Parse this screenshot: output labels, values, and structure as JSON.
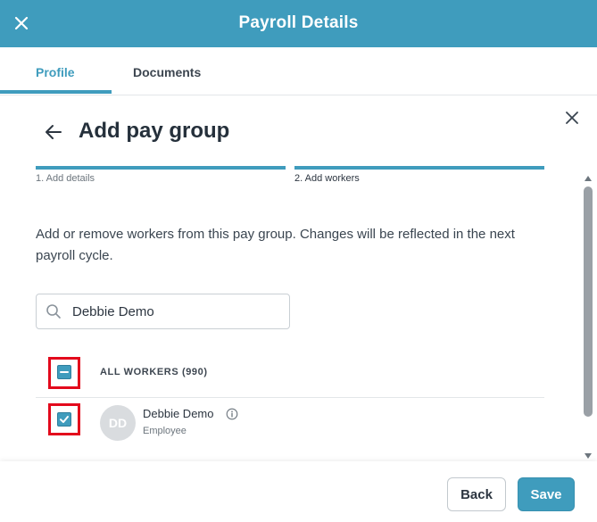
{
  "header": {
    "title": "Payroll Details"
  },
  "tabs": [
    {
      "label": "Profile",
      "active": true
    },
    {
      "label": "Documents",
      "active": false
    }
  ],
  "panel": {
    "heading": "Add pay group",
    "steps": [
      {
        "label": "1. Add details",
        "state": "completed"
      },
      {
        "label": "2. Add workers",
        "state": "current"
      }
    ],
    "description": "Add or remove workers from this pay group. Changes will be reflected in the next payroll cycle.",
    "search": {
      "value": "Debbie Demo",
      "placeholder": ""
    },
    "all_workers": {
      "label": "ALL WORKERS (990)",
      "checkbox_state": "indeterminate"
    },
    "workers": [
      {
        "initials": "DD",
        "name": "Debbie Demo",
        "role": "Employee",
        "checked": true
      }
    ]
  },
  "footer": {
    "back_label": "Back",
    "save_label": "Save"
  },
  "colors": {
    "accent": "#3f9cbd",
    "highlight_box": "#e3091c",
    "avatar_bg": "#d9dcdf"
  },
  "icons": [
    "close-icon",
    "back-arrow-icon",
    "search-icon",
    "info-icon",
    "check-icon",
    "minus-icon"
  ]
}
